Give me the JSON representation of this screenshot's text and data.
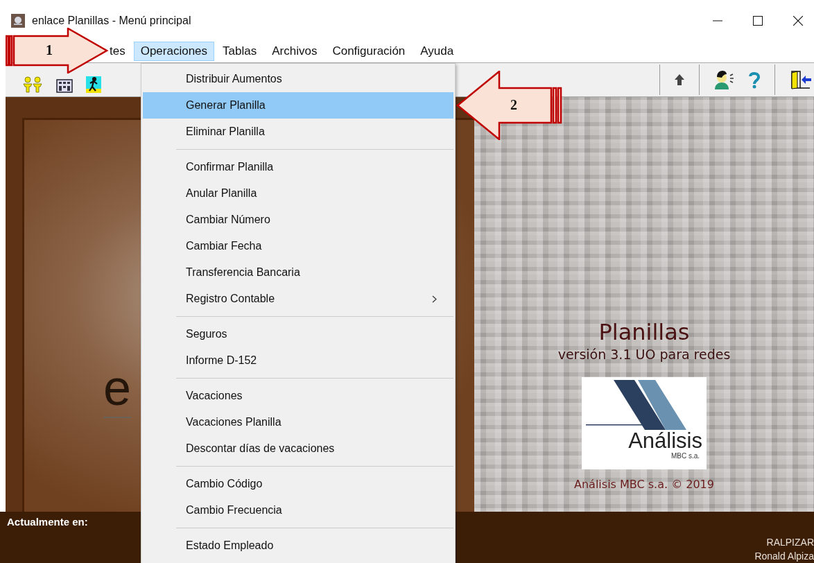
{
  "window": {
    "title": "enlace Planillas - Menú principal"
  },
  "menu_bar": [
    {
      "label": "tes",
      "selected": false
    },
    {
      "label": "Operaciones",
      "selected": true
    },
    {
      "label": "Tablas",
      "selected": false
    },
    {
      "label": "Archivos",
      "selected": false
    },
    {
      "label": "Configuración",
      "selected": false
    },
    {
      "label": "Ayuda",
      "selected": false
    }
  ],
  "dropdown": {
    "groups": [
      [
        {
          "label": "Distribuir Aumentos",
          "selected": false,
          "submenu": false
        },
        {
          "label": "Generar Planilla",
          "selected": true,
          "submenu": false
        },
        {
          "label": "Eliminar Planilla",
          "selected": false,
          "submenu": false
        }
      ],
      [
        {
          "label": "Confirmar Planilla",
          "selected": false,
          "submenu": false
        },
        {
          "label": "Anular Planilla",
          "selected": false,
          "submenu": false
        },
        {
          "label": "Cambiar Número",
          "selected": false,
          "submenu": false
        },
        {
          "label": "Cambiar Fecha",
          "selected": false,
          "submenu": false
        },
        {
          "label": "Transferencia Bancaria",
          "selected": false,
          "submenu": false
        },
        {
          "label": "Registro Contable",
          "selected": false,
          "submenu": true
        }
      ],
      [
        {
          "label": "Seguros",
          "selected": false,
          "submenu": false
        },
        {
          "label": "Informe D-152",
          "selected": false,
          "submenu": false
        }
      ],
      [
        {
          "label": "Vacaciones",
          "selected": false,
          "submenu": false
        },
        {
          "label": "Vacaciones Planilla",
          "selected": false,
          "submenu": false
        },
        {
          "label": "Descontar días de vacaciones",
          "selected": false,
          "submenu": false
        }
      ],
      [
        {
          "label": "Cambio Código",
          "selected": false,
          "submenu": false
        },
        {
          "label": "Cambio Frecuencia",
          "selected": false,
          "submenu": false
        }
      ],
      [
        {
          "label": "Estado Empleado",
          "selected": false,
          "submenu": false
        }
      ]
    ]
  },
  "left_logo": {
    "text": "e"
  },
  "splash": {
    "title": "Planillas",
    "subtitle": "versión 3.1 UO para redes",
    "logo_name": "Análisis",
    "logo_sub": "MBC s.a.",
    "copyright": "Análisis MBC s.a. © 2019"
  },
  "status_bar": {
    "label": "Actualmente en:",
    "user_id": "RALPIZAR",
    "user_name": "Ronald Alpiza"
  },
  "callouts": [
    {
      "number": "1",
      "kind": "right"
    },
    {
      "number": "2",
      "kind": "left"
    }
  ]
}
